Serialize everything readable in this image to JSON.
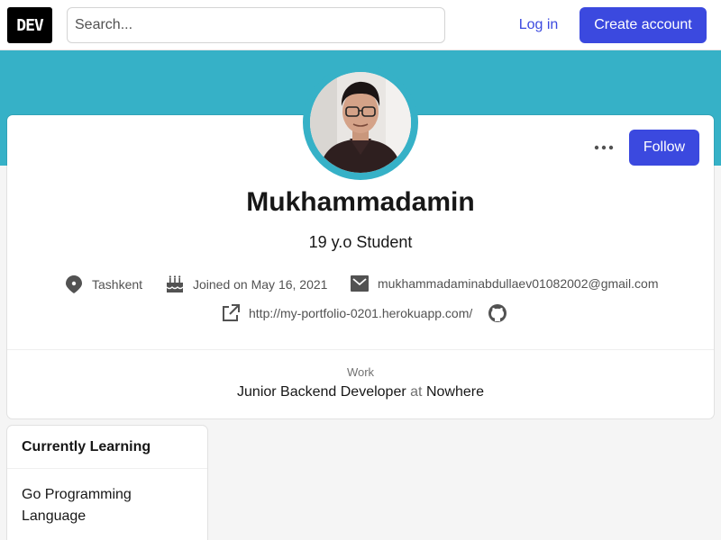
{
  "header": {
    "logo_text": "DEV",
    "search_placeholder": "Search...",
    "login_label": "Log in",
    "create_account_label": "Create account"
  },
  "profile": {
    "name": "Mukhammadamin",
    "bio": "19 y.o Student",
    "follow_label": "Follow",
    "location": "Tashkent",
    "joined": "Joined on May 16, 2021",
    "email": "mukhammadaminabdullaev01082002@gmail.com",
    "website": "http://my-portfolio-0201.herokuapp.com/",
    "work_label": "Work",
    "work_role": "Junior Backend Developer",
    "work_at": "at",
    "work_company": "Nowhere"
  },
  "learning": {
    "heading": "Currently Learning",
    "body": "Go Programming Language"
  },
  "colors": {
    "accent": "#3b49df",
    "banner": "#36b1c7"
  }
}
